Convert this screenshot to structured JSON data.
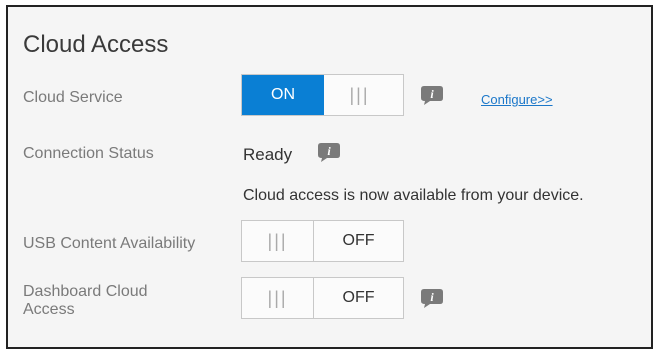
{
  "section": {
    "title": "Cloud Access"
  },
  "cloud_service": {
    "label": "Cloud Service",
    "toggle_on": "ON",
    "grip": "|||",
    "configure_link": "Configure>>"
  },
  "connection_status": {
    "label": "Connection Status",
    "value": "Ready",
    "message": "Cloud access is now available from your device."
  },
  "usb_content": {
    "label": "USB Content Availability",
    "grip": "|||",
    "toggle_off": "OFF"
  },
  "dashboard_cloud": {
    "label_line1": "Dashboard Cloud",
    "label_line2": "Access",
    "grip": "|||",
    "toggle_off": "OFF"
  },
  "colors": {
    "accent": "#0a7fd4",
    "link": "#1b77c9",
    "info_icon": "#7a7a7a"
  },
  "icons": [
    "info-icon"
  ]
}
